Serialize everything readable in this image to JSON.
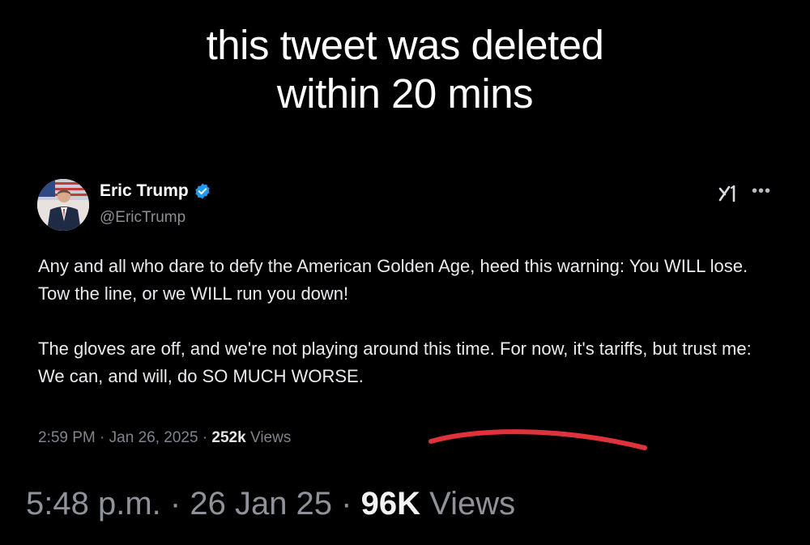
{
  "caption": {
    "line1": "this tweet was deleted",
    "line2": "within 20 mins"
  },
  "tweet": {
    "author_name": "Eric Trump",
    "handle": "@EricTrump",
    "verified_icon": "verified-badge-icon",
    "paragraph1": "Any and all who dare to defy the American Golden Age, heed this warning: You WILL lose. Tow the line, or we WILL run you down!",
    "paragraph2": "The gloves are off, and we're not playing around this time. For now, it's tariffs, but trust me: We can, and will, do SO MUCH WORSE.",
    "time": "2:59 PM",
    "date": "Jan 26, 2025",
    "views_count": "252k",
    "views_label": "Views",
    "separator": "·"
  },
  "outer_post": {
    "time": "5:48 p.m.",
    "date": "26 Jan 25",
    "views_count": "96K",
    "views_label": "Views",
    "separator": "·"
  },
  "colors": {
    "background": "#000000",
    "verified_blue": "#1d9bf0",
    "annotation_red": "#e0323a"
  }
}
